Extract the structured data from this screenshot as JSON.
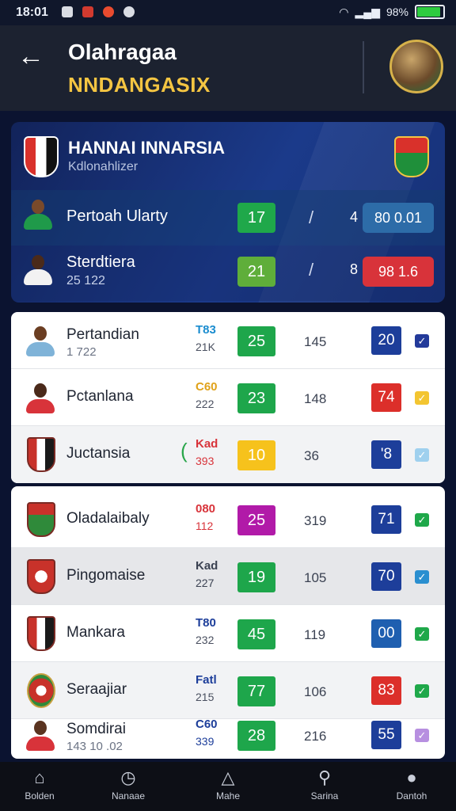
{
  "status": {
    "time": "18:01",
    "battery": "98%"
  },
  "header": {
    "title": "Olahragaa",
    "subtitle": "NNDANGASIX"
  },
  "featured": {
    "name": "HANNAI INNARSIA",
    "sub": "Kdlonahlizer",
    "rows": [
      {
        "name": "Pertoah Ularty",
        "sub": "",
        "score": "17",
        "slash": "/",
        "num": "4",
        "pill": "80 0.01"
      },
      {
        "name": "Sterdtiera",
        "sub": "25 122",
        "score": "21",
        "slash": "/",
        "num": "8",
        "pill": "98 1.6"
      }
    ]
  },
  "list1": [
    {
      "name": "Pertandian",
      "sub": "1 722",
      "code": "T83",
      "code2": "21K",
      "score": "25",
      "num": "145",
      "box": "20"
    },
    {
      "name": "Pctanlana",
      "sub": "",
      "code": "C60",
      "code2": "222",
      "score": "23",
      "num": "148",
      "box": "74"
    },
    {
      "name": "Juctansia",
      "sub": "",
      "code": "Kad",
      "code2": "393",
      "score": "10",
      "num": "36",
      "box": "'8"
    }
  ],
  "list2": [
    {
      "name": "Oladalaibaly",
      "code": "080",
      "code2": "112",
      "score": "25",
      "num": "319",
      "box": "71"
    },
    {
      "name": "Pingomaise",
      "code": "Kad",
      "code2": "227",
      "score": "19",
      "num": "105",
      "box": "70"
    },
    {
      "name": "Mankara",
      "code": "T80",
      "code2": "232",
      "score": "45",
      "num": "119",
      "box": "00"
    },
    {
      "name": "Seraajiar",
      "code": "Fatl",
      "code2": "215",
      "score": "77",
      "num": "106",
      "box": "83"
    },
    {
      "name": "Somdirai",
      "sub": "143 10 .02",
      "code": "C60",
      "code2": "339",
      "score": "28",
      "num": "216",
      "box": "55"
    }
  ],
  "nav": [
    {
      "label": "Bolden",
      "icon": "home-icon"
    },
    {
      "label": "Nanaae",
      "icon": "clock-icon"
    },
    {
      "label": "Mahe",
      "icon": "house-outline-icon"
    },
    {
      "label": "Sarina",
      "icon": "search-icon"
    },
    {
      "label": "Dantoh",
      "icon": "profile-icon"
    }
  ]
}
